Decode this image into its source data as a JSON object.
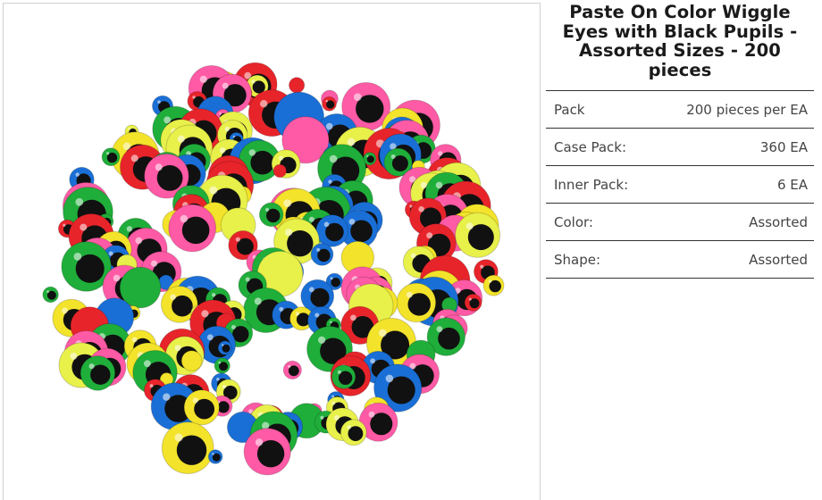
{
  "product": {
    "title": "Paste On Color Wiggle Eyes with Black Pupils - Assorted Sizes - 200 pieces",
    "image_description": "product-photo-wiggle-eyes"
  },
  "specs": [
    {
      "label": "Pack",
      "value": "200 pieces per EA"
    },
    {
      "label": "Case Pack:",
      "value": "360 EA"
    },
    {
      "label": "Inner Pack:",
      "value": "6 EA"
    },
    {
      "label": "Color:",
      "value": "Assorted"
    },
    {
      "label": "Shape:",
      "value": "Assorted"
    }
  ],
  "colors": {
    "border": "#333333",
    "eye_colors": [
      "#1a6fd6",
      "#e8242b",
      "#1fae3a",
      "#f3e32a",
      "#ff5aa5",
      "#e8f04a"
    ]
  }
}
